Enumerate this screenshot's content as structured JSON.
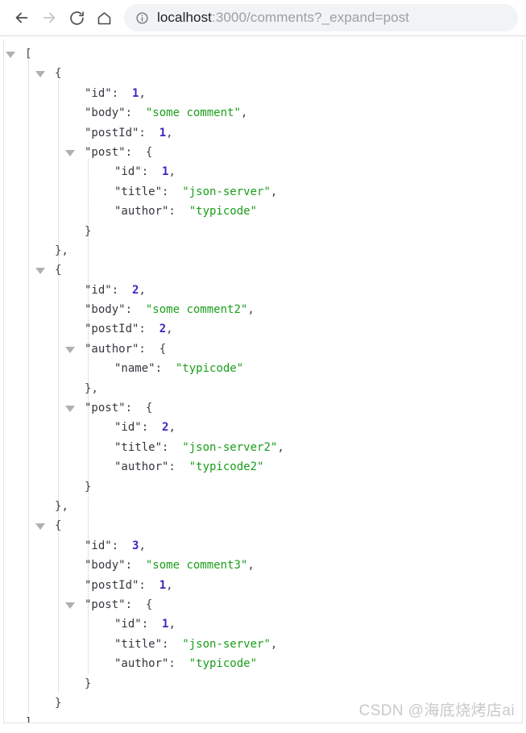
{
  "browser": {
    "back_icon": "back-arrow-icon",
    "forward_icon": "forward-arrow-icon",
    "reload_icon": "reload-icon",
    "home_icon": "home-icon",
    "info_icon": "site-info-icon",
    "url_host": "localhost",
    "url_path": ":3000/comments?_expand=post",
    "url_full": "localhost:3000/comments?_expand=post"
  },
  "json_document": {
    "root_type": "array",
    "lines": [
      {
        "indent": 0,
        "tri": true,
        "tri_indent": 0,
        "text": "[",
        "parts": [
          {
            "t": "[",
            "c": "brace"
          }
        ]
      },
      {
        "indent": 1,
        "tri": true,
        "tri_indent": 1,
        "text": "{",
        "parts": [
          {
            "t": "{",
            "c": "brace"
          }
        ]
      },
      {
        "indent": 2,
        "tri": false,
        "text": "\"id\":  1,",
        "parts": [
          {
            "t": "\"id\":",
            "c": "key"
          },
          {
            "t": "  ",
            "c": "punct"
          },
          {
            "t": "1",
            "c": "num"
          },
          {
            "t": ",",
            "c": "punct"
          }
        ]
      },
      {
        "indent": 2,
        "tri": false,
        "text": "\"body\":  \"some comment\",",
        "parts": [
          {
            "t": "\"body\":",
            "c": "key"
          },
          {
            "t": "  ",
            "c": "punct"
          },
          {
            "t": "\"some comment\"",
            "c": "str"
          },
          {
            "t": ",",
            "c": "punct"
          }
        ]
      },
      {
        "indent": 2,
        "tri": false,
        "text": "\"postId\":  1,",
        "parts": [
          {
            "t": "\"postId\":",
            "c": "key"
          },
          {
            "t": "  ",
            "c": "punct"
          },
          {
            "t": "1",
            "c": "num"
          },
          {
            "t": ",",
            "c": "punct"
          }
        ]
      },
      {
        "indent": 2,
        "tri": true,
        "tri_indent": 2,
        "text": "\"post\":  {",
        "parts": [
          {
            "t": "\"post\":",
            "c": "key"
          },
          {
            "t": "  ",
            "c": "punct"
          },
          {
            "t": "{",
            "c": "brace"
          }
        ]
      },
      {
        "indent": 3,
        "tri": false,
        "text": "\"id\":  1,",
        "parts": [
          {
            "t": "\"id\":",
            "c": "key"
          },
          {
            "t": "  ",
            "c": "punct"
          },
          {
            "t": "1",
            "c": "num"
          },
          {
            "t": ",",
            "c": "punct"
          }
        ]
      },
      {
        "indent": 3,
        "tri": false,
        "text": "\"title\":  \"json-server\",",
        "parts": [
          {
            "t": "\"title\":",
            "c": "key"
          },
          {
            "t": "  ",
            "c": "punct"
          },
          {
            "t": "\"json-server\"",
            "c": "str"
          },
          {
            "t": ",",
            "c": "punct"
          }
        ]
      },
      {
        "indent": 3,
        "tri": false,
        "text": "\"author\":  \"typicode\"",
        "parts": [
          {
            "t": "\"author\":",
            "c": "key"
          },
          {
            "t": "  ",
            "c": "punct"
          },
          {
            "t": "\"typicode\"",
            "c": "str"
          }
        ]
      },
      {
        "indent": 2,
        "tri": false,
        "text": "}",
        "parts": [
          {
            "t": "}",
            "c": "brace"
          }
        ]
      },
      {
        "indent": 1,
        "tri": false,
        "text": "},",
        "parts": [
          {
            "t": "}",
            "c": "brace"
          },
          {
            "t": ",",
            "c": "punct"
          }
        ]
      },
      {
        "indent": 1,
        "tri": true,
        "tri_indent": 1,
        "text": "{",
        "parts": [
          {
            "t": "{",
            "c": "brace"
          }
        ]
      },
      {
        "indent": 2,
        "tri": false,
        "text": "\"id\":  2,",
        "parts": [
          {
            "t": "\"id\":",
            "c": "key"
          },
          {
            "t": "  ",
            "c": "punct"
          },
          {
            "t": "2",
            "c": "num"
          },
          {
            "t": ",",
            "c": "punct"
          }
        ]
      },
      {
        "indent": 2,
        "tri": false,
        "text": "\"body\":  \"some comment2\",",
        "parts": [
          {
            "t": "\"body\":",
            "c": "key"
          },
          {
            "t": "  ",
            "c": "punct"
          },
          {
            "t": "\"some comment2\"",
            "c": "str"
          },
          {
            "t": ",",
            "c": "punct"
          }
        ]
      },
      {
        "indent": 2,
        "tri": false,
        "text": "\"postId\":  2,",
        "parts": [
          {
            "t": "\"postId\":",
            "c": "key"
          },
          {
            "t": "  ",
            "c": "punct"
          },
          {
            "t": "2",
            "c": "num"
          },
          {
            "t": ",",
            "c": "punct"
          }
        ]
      },
      {
        "indent": 2,
        "tri": true,
        "tri_indent": 2,
        "text": "\"author\":  {",
        "parts": [
          {
            "t": "\"author\":",
            "c": "key"
          },
          {
            "t": "  ",
            "c": "punct"
          },
          {
            "t": "{",
            "c": "brace"
          }
        ]
      },
      {
        "indent": 3,
        "tri": false,
        "text": "\"name\":  \"typicode\"",
        "parts": [
          {
            "t": "\"name\":",
            "c": "key"
          },
          {
            "t": "  ",
            "c": "punct"
          },
          {
            "t": "\"typicode\"",
            "c": "str"
          }
        ]
      },
      {
        "indent": 2,
        "tri": false,
        "text": "},",
        "parts": [
          {
            "t": "}",
            "c": "brace"
          },
          {
            "t": ",",
            "c": "punct"
          }
        ]
      },
      {
        "indent": 2,
        "tri": true,
        "tri_indent": 2,
        "text": "\"post\":  {",
        "parts": [
          {
            "t": "\"post\":",
            "c": "key"
          },
          {
            "t": "  ",
            "c": "punct"
          },
          {
            "t": "{",
            "c": "brace"
          }
        ]
      },
      {
        "indent": 3,
        "tri": false,
        "text": "\"id\":  2,",
        "parts": [
          {
            "t": "\"id\":",
            "c": "key"
          },
          {
            "t": "  ",
            "c": "punct"
          },
          {
            "t": "2",
            "c": "num"
          },
          {
            "t": ",",
            "c": "punct"
          }
        ]
      },
      {
        "indent": 3,
        "tri": false,
        "text": "\"title\":  \"json-server2\",",
        "parts": [
          {
            "t": "\"title\":",
            "c": "key"
          },
          {
            "t": "  ",
            "c": "punct"
          },
          {
            "t": "\"json-server2\"",
            "c": "str"
          },
          {
            "t": ",",
            "c": "punct"
          }
        ]
      },
      {
        "indent": 3,
        "tri": false,
        "text": "\"author\":  \"typicode2\"",
        "parts": [
          {
            "t": "\"author\":",
            "c": "key"
          },
          {
            "t": "  ",
            "c": "punct"
          },
          {
            "t": "\"typicode2\"",
            "c": "str"
          }
        ]
      },
      {
        "indent": 2,
        "tri": false,
        "text": "}",
        "parts": [
          {
            "t": "}",
            "c": "brace"
          }
        ]
      },
      {
        "indent": 1,
        "tri": false,
        "text": "},",
        "parts": [
          {
            "t": "}",
            "c": "brace"
          },
          {
            "t": ",",
            "c": "punct"
          }
        ]
      },
      {
        "indent": 1,
        "tri": true,
        "tri_indent": 1,
        "text": "{",
        "parts": [
          {
            "t": "{",
            "c": "brace"
          }
        ]
      },
      {
        "indent": 2,
        "tri": false,
        "text": "\"id\":  3,",
        "parts": [
          {
            "t": "\"id\":",
            "c": "key"
          },
          {
            "t": "  ",
            "c": "punct"
          },
          {
            "t": "3",
            "c": "num"
          },
          {
            "t": ",",
            "c": "punct"
          }
        ]
      },
      {
        "indent": 2,
        "tri": false,
        "text": "\"body\":  \"some comment3\",",
        "parts": [
          {
            "t": "\"body\":",
            "c": "key"
          },
          {
            "t": "  ",
            "c": "punct"
          },
          {
            "t": "\"some comment3\"",
            "c": "str"
          },
          {
            "t": ",",
            "c": "punct"
          }
        ]
      },
      {
        "indent": 2,
        "tri": false,
        "text": "\"postId\":  1,",
        "parts": [
          {
            "t": "\"postId\":",
            "c": "key"
          },
          {
            "t": "  ",
            "c": "punct"
          },
          {
            "t": "1",
            "c": "num"
          },
          {
            "t": ",",
            "c": "punct"
          }
        ]
      },
      {
        "indent": 2,
        "tri": true,
        "tri_indent": 2,
        "text": "\"post\":  {",
        "parts": [
          {
            "t": "\"post\":",
            "c": "key"
          },
          {
            "t": "  ",
            "c": "punct"
          },
          {
            "t": "{",
            "c": "brace"
          }
        ]
      },
      {
        "indent": 3,
        "tri": false,
        "text": "\"id\":  1,",
        "parts": [
          {
            "t": "\"id\":",
            "c": "key"
          },
          {
            "t": "  ",
            "c": "punct"
          },
          {
            "t": "1",
            "c": "num"
          },
          {
            "t": ",",
            "c": "punct"
          }
        ]
      },
      {
        "indent": 3,
        "tri": false,
        "text": "\"title\":  \"json-server\",",
        "parts": [
          {
            "t": "\"title\":",
            "c": "key"
          },
          {
            "t": "  ",
            "c": "punct"
          },
          {
            "t": "\"json-server\"",
            "c": "str"
          },
          {
            "t": ",",
            "c": "punct"
          }
        ]
      },
      {
        "indent": 3,
        "tri": false,
        "text": "\"author\":  \"typicode\"",
        "parts": [
          {
            "t": "\"author\":",
            "c": "key"
          },
          {
            "t": "  ",
            "c": "punct"
          },
          {
            "t": "\"typicode\"",
            "c": "str"
          }
        ]
      },
      {
        "indent": 2,
        "tri": false,
        "text": "}",
        "parts": [
          {
            "t": "}",
            "c": "brace"
          }
        ]
      },
      {
        "indent": 1,
        "tri": false,
        "text": "}",
        "parts": [
          {
            "t": "}",
            "c": "brace"
          }
        ]
      },
      {
        "indent": 0,
        "tri": false,
        "text": "]",
        "parts": [
          {
            "t": "]",
            "c": "brace"
          }
        ]
      }
    ]
  },
  "watermark": {
    "text": "CSDN @海底烧烤店ai"
  },
  "colors": {
    "string": "#1a9e1a",
    "number": "#3b26c4",
    "key": "#36363f",
    "brace": "#4a3b4f",
    "guide": "#c9c9c9",
    "triangle": "#b0b0b0",
    "omnibox_bg": "#f1f3f4",
    "url_host": "#202124",
    "url_rest": "#9aa0a6"
  }
}
